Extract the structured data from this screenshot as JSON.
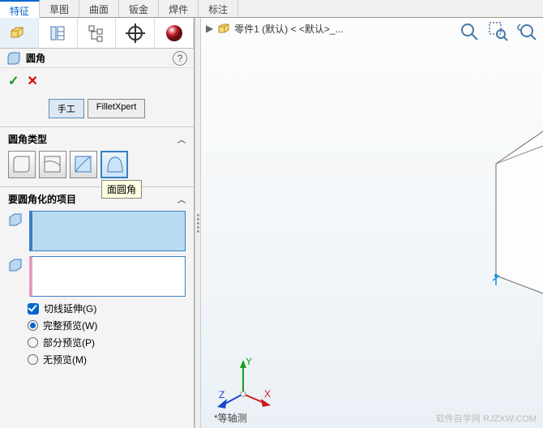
{
  "tabs": {
    "items": [
      "特征",
      "草图",
      "曲面",
      "钣金",
      "焊件",
      "标注"
    ],
    "activeIndex": 0
  },
  "panel": {
    "feature_icon": "fillet-icon",
    "feature_title": "圆角",
    "help": "?",
    "ok": "✓",
    "cancel": "✕",
    "methods": {
      "manual": "手工",
      "filletxpert": "FilletXpert"
    },
    "type_section_title": "圆角类型",
    "tooltip": "面圆角",
    "items_section_title": "要圆角化的项目",
    "options": {
      "tangent": "切线延伸(G)",
      "full_preview": "完整预览(W)",
      "partial_preview": "部分预览(P)",
      "no_preview": "无预览(M)"
    }
  },
  "viewport": {
    "crumb_part": "零件1 (默认) < <默认>_...",
    "view_label": "*等轴测"
  },
  "watermark": "软件自学网 RJZXW.COM"
}
